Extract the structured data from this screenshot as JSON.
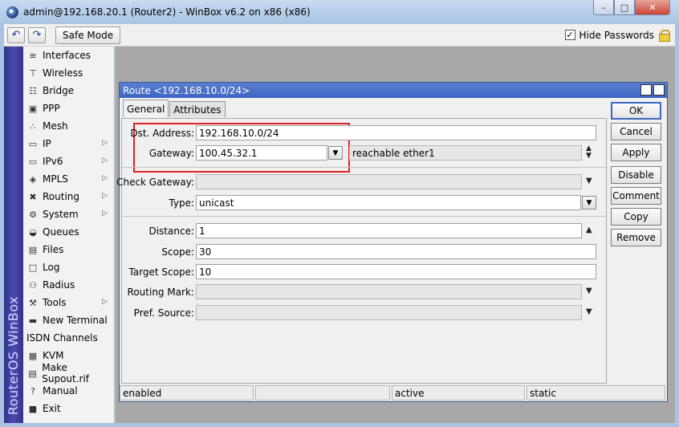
{
  "window": {
    "title": "admin@192.168.20.1 (Router2) - WinBox v6.2 on x86 (x86)",
    "controls": {
      "minimize": "–",
      "maximize": "□",
      "close": "✕"
    }
  },
  "toolbar": {
    "undo_icon": "↶",
    "redo_icon": "↷",
    "safe_mode": "Safe Mode",
    "hide_passwords": {
      "label": "Hide Passwords",
      "checked": true,
      "mark": "✓"
    }
  },
  "brand": "RouterOS WinBox",
  "sidebar": {
    "items": [
      {
        "label": "Interfaces",
        "icon": "interfaces-icon",
        "glyph": "≡",
        "submenu": false
      },
      {
        "label": "Wireless",
        "icon": "wireless-icon",
        "glyph": "⊤",
        "submenu": false
      },
      {
        "label": "Bridge",
        "icon": "bridge-icon",
        "glyph": "☷",
        "submenu": false
      },
      {
        "label": "PPP",
        "icon": "ppp-icon",
        "glyph": "▣",
        "submenu": false
      },
      {
        "label": "Mesh",
        "icon": "mesh-icon",
        "glyph": "∴",
        "submenu": false
      },
      {
        "label": "IP",
        "icon": "ip-icon",
        "glyph": "▭",
        "submenu": true
      },
      {
        "label": "IPv6",
        "icon": "ipv6-icon",
        "glyph": "▭",
        "submenu": true
      },
      {
        "label": "MPLS",
        "icon": "mpls-icon",
        "glyph": "◈",
        "submenu": true
      },
      {
        "label": "Routing",
        "icon": "routing-icon",
        "glyph": "✖",
        "submenu": true
      },
      {
        "label": "System",
        "icon": "system-icon",
        "glyph": "⚙",
        "submenu": true
      },
      {
        "label": "Queues",
        "icon": "queues-icon",
        "glyph": "◒",
        "submenu": false
      },
      {
        "label": "Files",
        "icon": "files-icon",
        "glyph": "▤",
        "submenu": false
      },
      {
        "label": "Log",
        "icon": "log-icon",
        "glyph": "□",
        "submenu": false
      },
      {
        "label": "Radius",
        "icon": "radius-icon",
        "glyph": "⚇",
        "submenu": false
      },
      {
        "label": "Tools",
        "icon": "tools-icon",
        "glyph": "⚒",
        "submenu": true
      },
      {
        "label": "New Terminal",
        "icon": "terminal-icon",
        "glyph": "▬",
        "submenu": false
      },
      {
        "label": "ISDN Channels",
        "icon": "",
        "glyph": "",
        "submenu": false
      },
      {
        "label": "KVM",
        "icon": "kvm-icon",
        "glyph": "▦",
        "submenu": false
      },
      {
        "label": "Make Supout.rif",
        "icon": "supout-icon",
        "glyph": "▤",
        "submenu": false
      },
      {
        "label": "Manual",
        "icon": "manual-icon",
        "glyph": "?",
        "submenu": false
      },
      {
        "label": "Exit",
        "icon": "exit-icon",
        "glyph": "■",
        "submenu": false
      }
    ],
    "submenu_arrow": "▷"
  },
  "dialog": {
    "title": "Route <192.168.10.0/24>",
    "controls": {
      "restore": "□",
      "close": "✕"
    },
    "tabs": [
      "General",
      "Attributes"
    ],
    "fields": {
      "dst_address": {
        "label": "Dst. Address:",
        "value": "192.168.10.0/24"
      },
      "gateway": {
        "label": "Gateway:",
        "value": "100.45.32.1",
        "status": "reachable ether1"
      },
      "check_gateway": {
        "label": "Check Gateway:",
        "value": ""
      },
      "type": {
        "label": "Type:",
        "value": "unicast"
      },
      "distance": {
        "label": "Distance:",
        "value": "1"
      },
      "scope": {
        "label": "Scope:",
        "value": "30"
      },
      "target_scope": {
        "label": "Target Scope:",
        "value": "10"
      },
      "routing_mark": {
        "label": "Routing Mark:",
        "value": ""
      },
      "pref_source": {
        "label": "Pref. Source:",
        "value": ""
      }
    },
    "buttons": [
      "OK",
      "Cancel",
      "Apply",
      "Disable",
      "Comment",
      "Copy",
      "Remove"
    ],
    "status": [
      "enabled",
      "",
      "active",
      "static"
    ]
  }
}
